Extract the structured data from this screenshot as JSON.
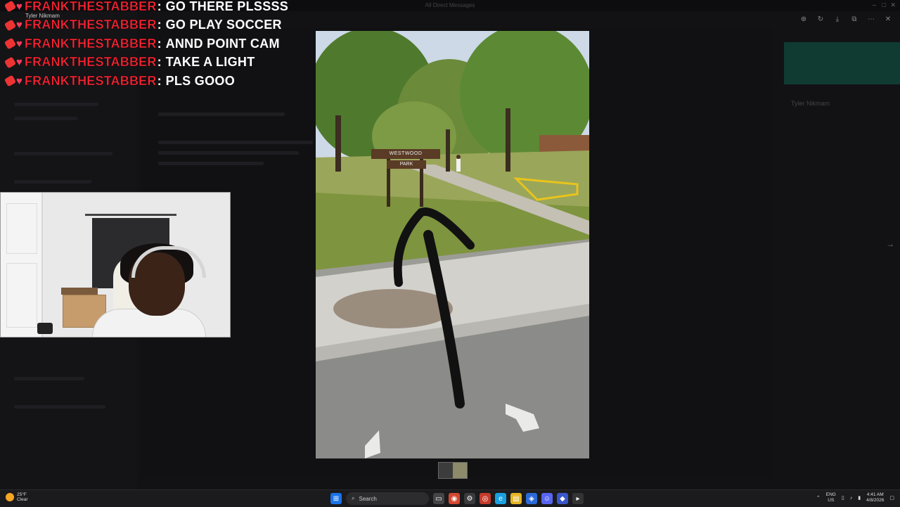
{
  "background_app": {
    "window_title": "All Direct Messages",
    "overlay_user": "Tyler Nikmam",
    "right_panel_user": "Tyler Nikmam"
  },
  "chat_overlay": {
    "messages": [
      {
        "user": "FRANKTHESTABBER",
        "text": "GO THERE PLSSSS"
      },
      {
        "user": "FRANKTHESTABBER",
        "text": "GO PLAY SOCCER"
      },
      {
        "user": "FRANKTHESTABBER",
        "text": "ANND POINT CAM"
      },
      {
        "user": "FRANKTHESTABBER",
        "text": "TAKE A LIGHT"
      },
      {
        "user": "FRANKTHESTABBER",
        "text": "PLS GOOO"
      }
    ],
    "username_color": "#ff2433"
  },
  "street_view": {
    "sign_line1": "WESTWOOD",
    "sign_line2": "PARK"
  },
  "viewer_tools": [
    "zoom-in-icon",
    "rotate-icon",
    "download-icon",
    "open-external-icon",
    "more-icon"
  ],
  "taskbar": {
    "weather_temp": "25°F",
    "weather_desc": "Clear",
    "search_label": "Search",
    "lang_line1": "ENG",
    "lang_line2": "US",
    "time": "4:41 AM",
    "date": "4/8/2026"
  }
}
